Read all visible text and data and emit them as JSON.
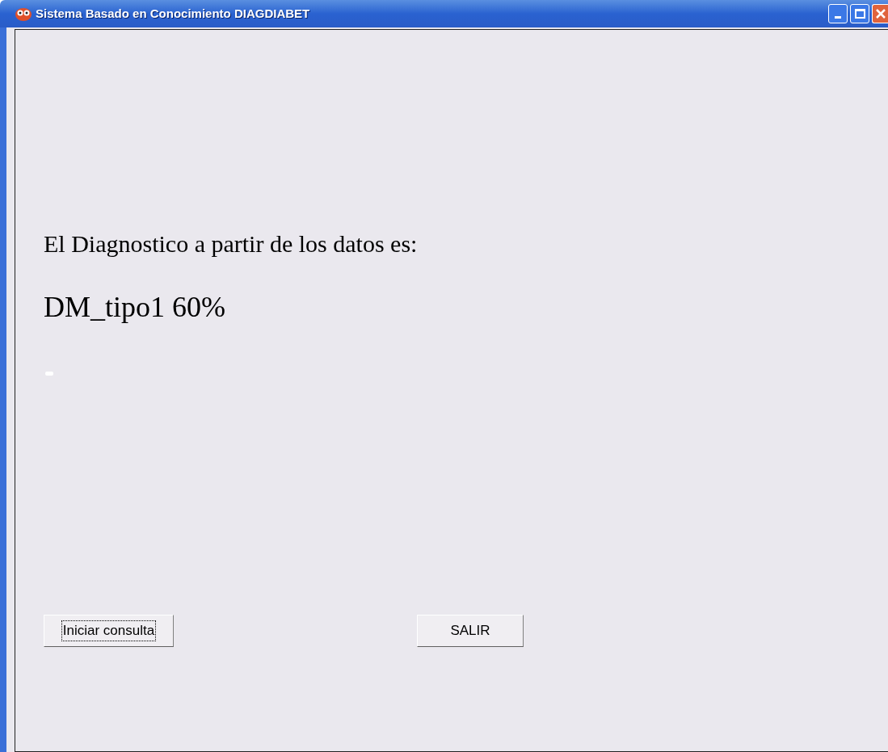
{
  "window": {
    "title": "Sistema Basado en Conocimiento DIAGDIABET"
  },
  "result": {
    "heading": "El Diagnostico a partir de los datos es:",
    "diagnosis": "DM_tipo1 60%"
  },
  "buttons": [
    {
      "label": "Iniciar consulta",
      "focused": true
    },
    {
      "label": "SALIR",
      "focused": false
    }
  ]
}
